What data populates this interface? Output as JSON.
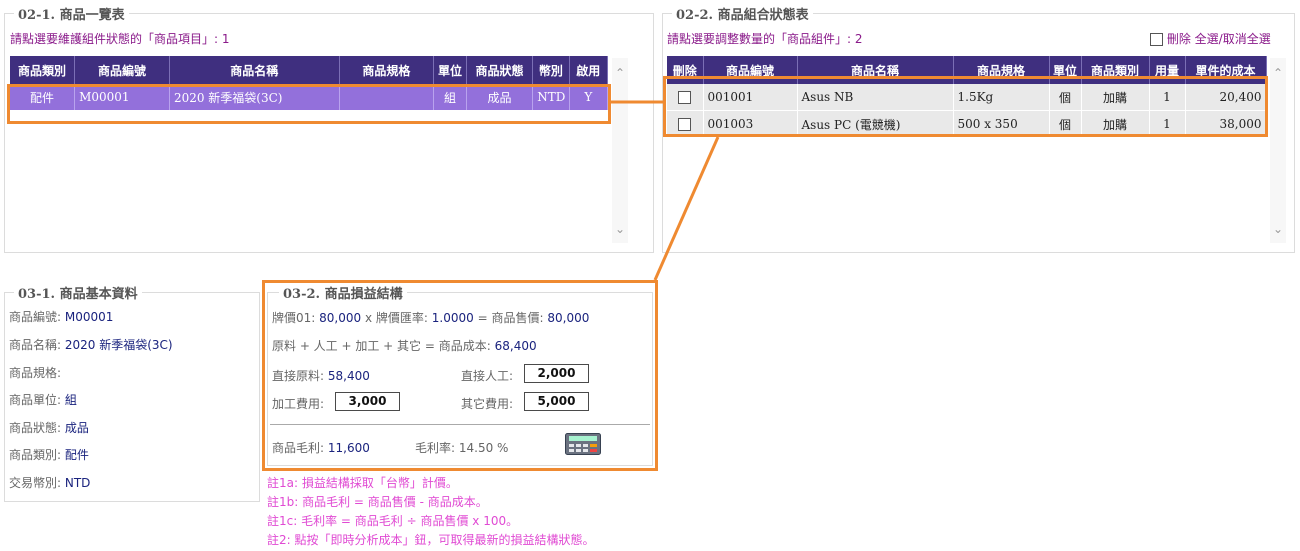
{
  "left_panel": {
    "legend": "02-1. 商品一覽表",
    "hint": "請點選要維護組件狀態的「商品項目」: 1",
    "columns": [
      "商品類別",
      "商品編號",
      "商品名稱",
      "商品規格",
      "單位",
      "商品狀態",
      "幣別",
      "啟用"
    ],
    "rows": [
      {
        "category": "配件",
        "code": "M00001",
        "name": "2020 新季福袋(3C)",
        "spec": "",
        "unit": "組",
        "status": "成品",
        "currency": "NTD",
        "enabled": "Y"
      }
    ]
  },
  "right_panel": {
    "legend": "02-2. 商品組合狀態表",
    "hint": "請點選要調整數量的「商品組件」: 2",
    "delete_label": "刪除",
    "select_all_label": "全選/取消全選",
    "columns": [
      "刪除",
      "商品編號",
      "商品名稱",
      "商品規格",
      "單位",
      "商品類別",
      "用量",
      "單件的成本"
    ],
    "rows": [
      {
        "code": "001001",
        "name": "Asus NB",
        "spec": "1.5Kg",
        "unit": "個",
        "category": "加購",
        "qty": "1",
        "cost": "20,400"
      },
      {
        "code": "001003",
        "name": "Asus PC (電競機)",
        "spec": "500 x 350",
        "unit": "個",
        "category": "加購",
        "qty": "1",
        "cost": "38,000"
      }
    ]
  },
  "basic_info": {
    "legend": "03-1. 商品基本資料",
    "fields": [
      {
        "label": "商品編號:",
        "value": "M00001"
      },
      {
        "label": "商品名稱:",
        "value": "2020 新季福袋(3C)"
      },
      {
        "label": "商品規格:",
        "value": ""
      },
      {
        "label": "商品單位:",
        "value": "組"
      },
      {
        "label": "商品狀態:",
        "value": "成品"
      },
      {
        "label": "商品類別:",
        "value": "配件"
      },
      {
        "label": "交易幣別:",
        "value": "NTD"
      }
    ]
  },
  "profit": {
    "legend": "03-2. 商品損益結構",
    "line1": {
      "a": "牌價01:",
      "b": "80,000",
      "c": "x 牌價匯率:",
      "d": "1.0000",
      "e": "= 商品售價:",
      "f": "80,000"
    },
    "line2": {
      "a": "原料 + 人工 + 加工 + 其它 = 商品成本:",
      "b": "68,400"
    },
    "raw_label": "直接原料:",
    "raw_value": "58,400",
    "labor_label": "直接人工:",
    "labor_value": "2,000",
    "process_label": "加工費用:",
    "process_value": "3,000",
    "other_label": "其它費用:",
    "other_value": "5,000",
    "gross_label": "商品毛利:",
    "gross_value": "11,600",
    "margin_label": "毛利率:",
    "margin_value": "14.50 %"
  },
  "notes": [
    "註1a: 損益結構採取「台幣」計價。",
    "註1b: 商品毛利 = 商品售價 - 商品成本。",
    "註1c: 毛利率 = 商品毛利 ÷ 商品售價 x 100。",
    "註2: 點按「即時分析成本」鈕，可取得最新的損益結構狀態。"
  ],
  "colors": {
    "accent": "#ef8a31",
    "header": "#3f2f7f",
    "selected_row": "#9370db",
    "hint": "#8a1a8a",
    "note": "#e04ad3",
    "value": "#1a237e"
  }
}
